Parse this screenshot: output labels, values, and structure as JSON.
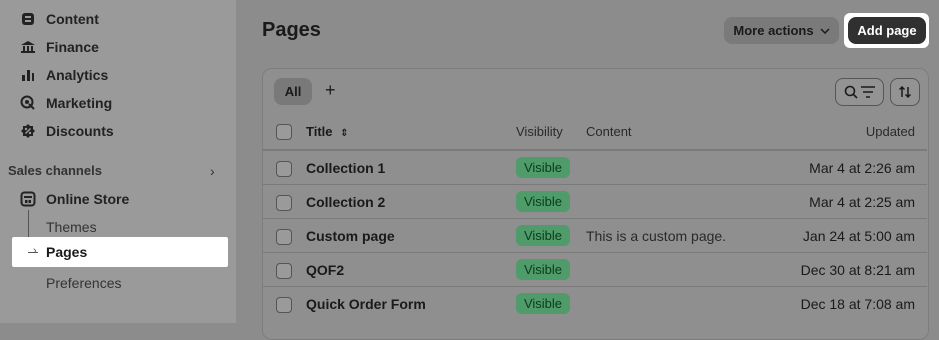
{
  "sidebar": {
    "items": [
      {
        "label": "Content",
        "icon": "content-icon"
      },
      {
        "label": "Finance",
        "icon": "bank-icon"
      },
      {
        "label": "Analytics",
        "icon": "bar-chart-icon"
      },
      {
        "label": "Marketing",
        "icon": "target-icon"
      },
      {
        "label": "Discounts",
        "icon": "discount-icon"
      }
    ],
    "sales_channels_label": "Sales channels",
    "online_store": "Online Store",
    "sub_items": [
      "Themes",
      "Pages",
      "Preferences"
    ]
  },
  "header": {
    "title": "Pages",
    "more_actions": "More actions",
    "add_page": "Add page"
  },
  "tabs": {
    "all": "All",
    "add": "+"
  },
  "table": {
    "columns": {
      "title": "Title",
      "visibility": "Visibility",
      "content": "Content",
      "updated": "Updated"
    },
    "rows": [
      {
        "title": "Collection 1",
        "visibility": "Visible",
        "content": "",
        "updated": "Mar 4 at 2:26 am"
      },
      {
        "title": "Collection 2",
        "visibility": "Visible",
        "content": "",
        "updated": "Mar 4 at 2:25 am"
      },
      {
        "title": "Custom page",
        "visibility": "Visible",
        "content": "This is a custom page.",
        "updated": "Jan 24 at 5:00 am"
      },
      {
        "title": "QOF2",
        "visibility": "Visible",
        "content": "",
        "updated": "Dec 30 at 8:21 am"
      },
      {
        "title": "Quick Order Form",
        "visibility": "Visible",
        "content": "",
        "updated": "Dec 18 at 7:08 am"
      }
    ]
  },
  "colors": {
    "badge": "#4f9b6a",
    "primary_button": "#303030"
  }
}
